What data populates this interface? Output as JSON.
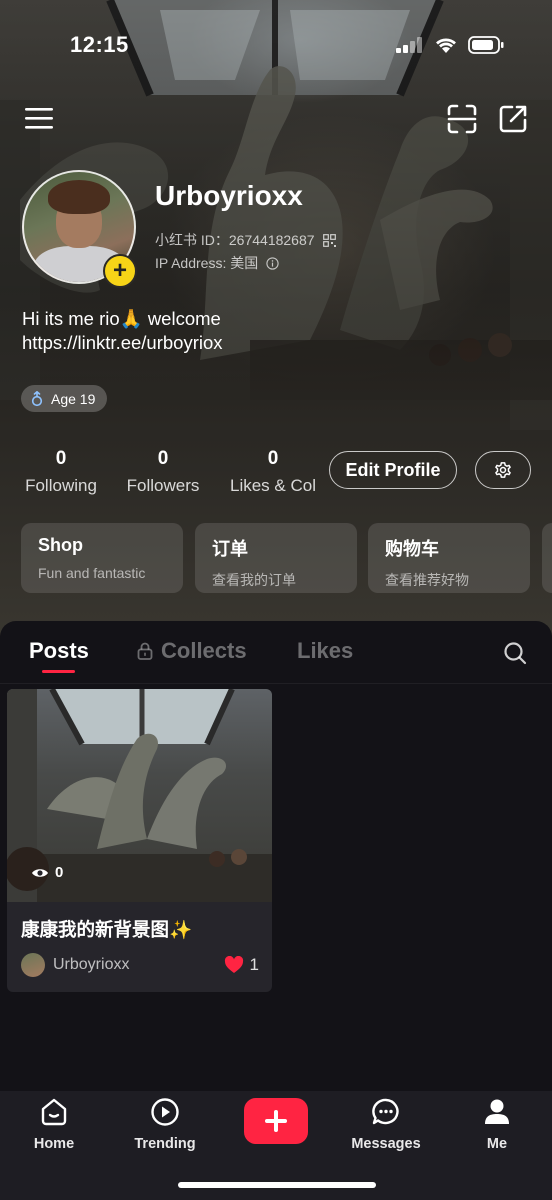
{
  "status_bar": {
    "time": "12:15"
  },
  "profile": {
    "username": "Urboyrioxx",
    "id_label": "小红书 ID：26744182687",
    "ip_label": "IP Address: 美国",
    "bio_line1": "Hi its me rio🙏 welcome",
    "bio_line2": "https://linktr.ee/urboyriox",
    "age_tag": "Age 19",
    "add_badge": "+"
  },
  "stats": [
    {
      "value": "0",
      "label": "Following"
    },
    {
      "value": "0",
      "label": "Followers"
    },
    {
      "value": "0",
      "label": "Likes & Col"
    }
  ],
  "buttons": {
    "edit_profile": "Edit Profile"
  },
  "cards": [
    {
      "title": "Shop",
      "subtitle": "Fun and fantastic"
    },
    {
      "title": "订单",
      "subtitle": "查看我的订单"
    },
    {
      "title": "购物车",
      "subtitle": "查看推荐好物"
    }
  ],
  "tabs": [
    {
      "label": "Posts",
      "active": true
    },
    {
      "label": "Collects",
      "active": false
    },
    {
      "label": "Likes",
      "active": false
    }
  ],
  "posts": [
    {
      "title": "康康我的新背景图✨",
      "author": "Urboyrioxx",
      "views": "0",
      "likes": "1"
    }
  ],
  "nav": [
    {
      "label": "Home",
      "icon": "home-icon"
    },
    {
      "label": "Trending",
      "icon": "play-circle-icon"
    },
    {
      "label": "",
      "icon": "plus-icon"
    },
    {
      "label": "Messages",
      "icon": "chat-bubble-icon"
    },
    {
      "label": "Me",
      "icon": "person-icon"
    }
  ],
  "colors": {
    "accent": "#ff2442",
    "badge": "#f7d417",
    "background": "#131217"
  }
}
